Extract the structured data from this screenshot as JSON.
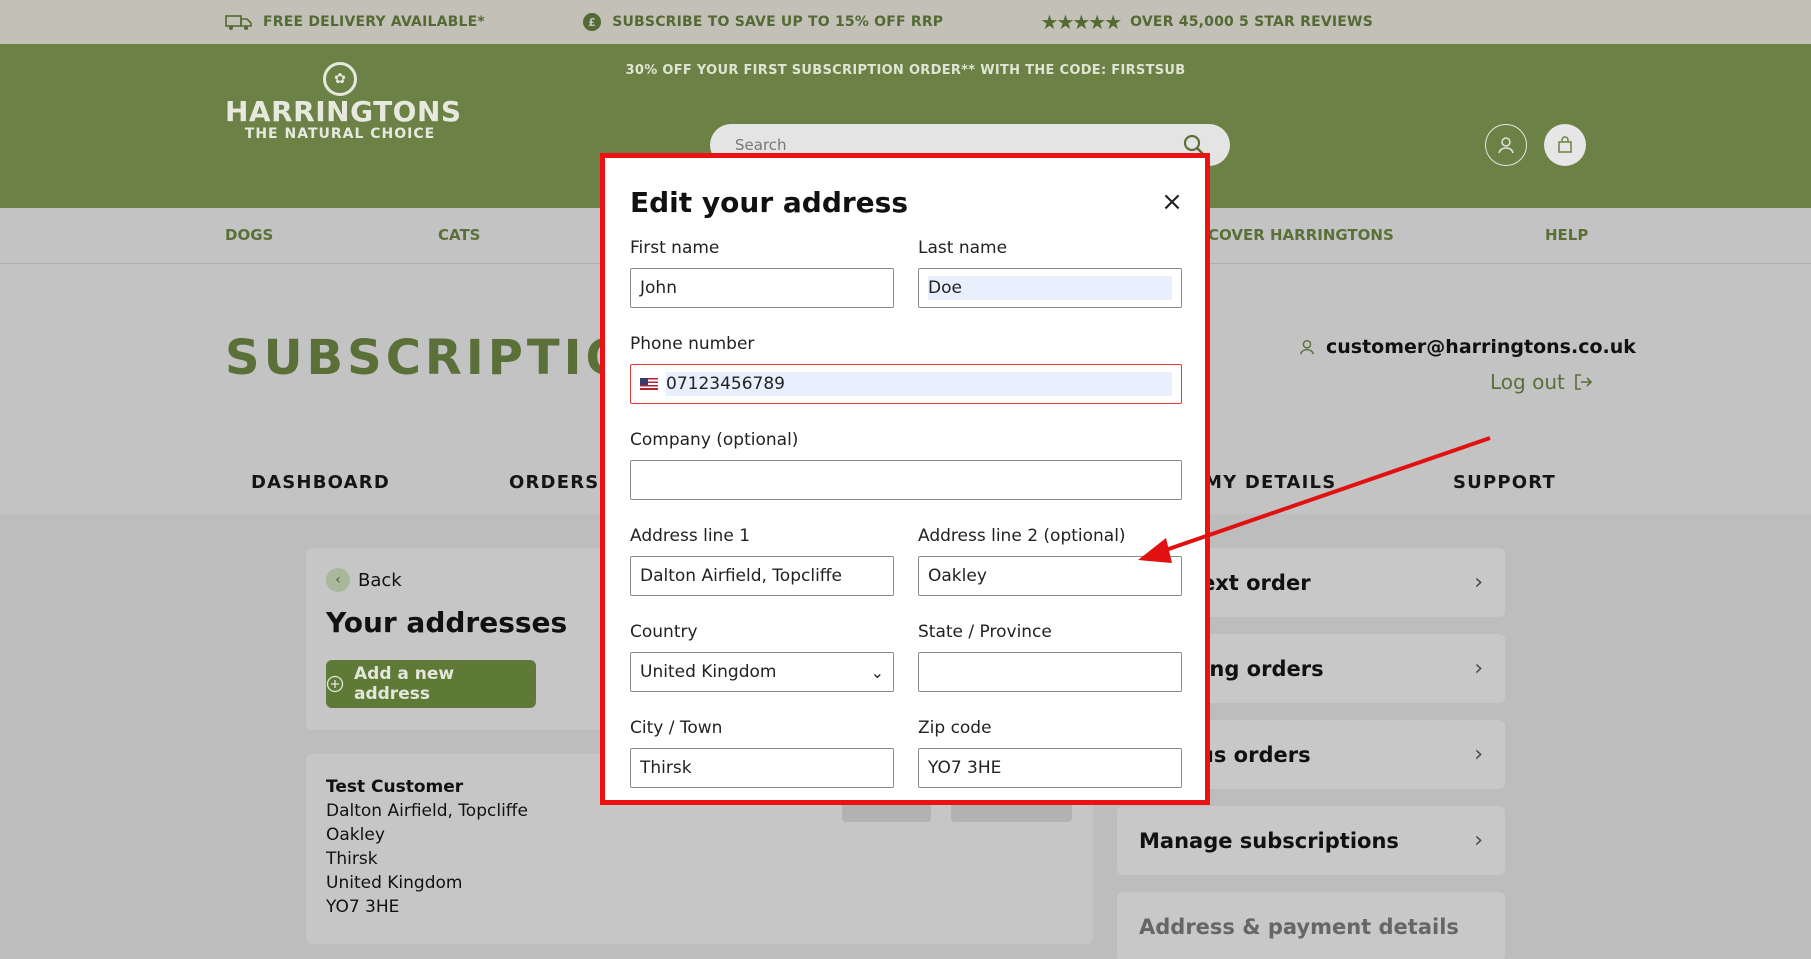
{
  "topbar": {
    "delivery": "FREE DELIVERY AVAILABLE*",
    "subscribe": "SUBSCRIBE TO SAVE UP TO 15% OFF RRP",
    "reviews": "OVER 45,000 5 STAR REVIEWS"
  },
  "promo": "30% OFF YOUR FIRST SUBSCRIPTION ORDER** WITH THE CODE: FIRSTSUB",
  "logo": {
    "name": "HARRINGTONS",
    "tagline": "THE NATURAL CHOICE"
  },
  "search": {
    "placeholder": "Search"
  },
  "nav": {
    "dogs": "DOGS",
    "cats": "CATS",
    "discover": "COVER HARRINGTONS",
    "help": "HELP"
  },
  "page": {
    "title": "SUBSCRIPTIONS",
    "email": "customer@harringtons.co.uk",
    "logout": "Log out"
  },
  "tabs": {
    "dashboard": "DASHBOARD",
    "orders": "ORDERS",
    "details": "MY DETAILS",
    "support": "SUPPORT"
  },
  "addresses": {
    "back": "Back",
    "title": "Your addresses",
    "add_button": "Add a new address",
    "entry": {
      "name": "Test Customer",
      "line1": "Dalton Airfield, Topcliffe",
      "line2": "Oakley",
      "city": "Thirsk",
      "country": "United Kingdom",
      "zip": "YO7 3HE"
    }
  },
  "sidebar": {
    "next_order": "our next order",
    "upcoming": "ocoming orders",
    "previous": "revious orders",
    "manage": "Manage subscriptions",
    "address_payment": "Address & payment details"
  },
  "modal": {
    "title": "Edit your address",
    "first_name_label": "First name",
    "first_name": "John",
    "last_name_label": "Last name",
    "last_name": "Doe",
    "phone_label": "Phone number",
    "phone": "07123456789",
    "company_label": "Company (optional)",
    "company": "",
    "address1_label": "Address line 1",
    "address1": "Dalton Airfield, Topcliffe",
    "address2_label": "Address line 2 (optional)",
    "address2": "Oakley",
    "country_label": "Country",
    "country": "United Kingdom",
    "state_label": "State / Province",
    "state": "",
    "city_label": "City / Town",
    "city": "Thirsk",
    "zip_label": "Zip code",
    "zip": "YO7 3HE"
  },
  "colors": {
    "brand_green": "#6b8145",
    "annotation_red": "#e11111"
  }
}
